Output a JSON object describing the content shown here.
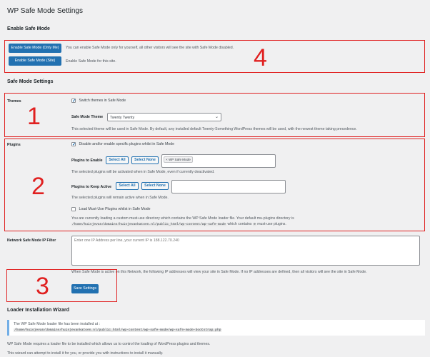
{
  "page": {
    "title": "WP Safe Mode Settings"
  },
  "enable_section": {
    "heading": "Enable Safe Mode",
    "only_me_button": "Enable Safe Mode (Only Me)",
    "only_me_desc": "You can enable Safe Mode only for yourself, all other visitors will see the site with Safe Mode disabled.",
    "site_button": "Enable Safe Mode (Site)",
    "site_desc": "Enable Safe Mode for this site."
  },
  "settings_section": {
    "heading": "Safe Mode Settings"
  },
  "themes": {
    "label": "Themes",
    "switch_checkbox_label": "Switch themes in Safe Mode",
    "switch_checked": true,
    "theme_label": "Safe Mode Theme",
    "theme_value": "Twenty Twenty",
    "desc": "This selected theme will be used in Safe Mode. By default, any installed default Twenty-Something WordPress themes will be used, with the newest theme taking precedence."
  },
  "plugins": {
    "label": "Plugins",
    "disable_checkbox_label": "Disable and/or enable specific plugins whilst in Safe Mode",
    "disable_checked": true,
    "enable_label": "Plugins to Enable",
    "select_all": "Select All",
    "select_none": "Select None",
    "enable_chip": "× WP Safe Mode",
    "enable_desc": "The selected plugins will be activated when in Safe Mode, even if currently deactivated.",
    "keep_label": "Plugins to Keep Active",
    "keep_desc": "The selected plugins will remain active when in Safe Mode.",
    "mu_checkbox_label": "Load Must-Use Plugins whilst in Safe Mode",
    "mu_checked": false,
    "mu_desc_1": "You are currently loading a custom must-use directory which contains the WP Safe Mode loader file. Your default mu-plugins directory is",
    "mu_path": "/home/huisjevan/domains/huisjevankatoen.nl/public_html/wp-content/wp-safe-mode",
    "mu_desc_2": "which contains",
    "mu_count": "0",
    "mu_desc_3": "must-use plugins."
  },
  "ip_filter": {
    "label": "Network Safe Mode IP Filter",
    "placeholder": "Enter one IP Address per line, your current IP is 188.122.70.240",
    "desc": "When Safe Mode is active on this Network, the following IP addresses will view your site in Safe Mode. If no IP addresses are defined, then all visitors will see the site in Safe Mode."
  },
  "save_button": "Save Settings",
  "loader": {
    "heading": "Loader Installation Wizard",
    "notice_line1": "The WP Safe Mode loader file has been installed at :",
    "notice_path": "/home/huisjevan/domains/huisjevankatoen.nl/public_html/wp-content/wp-safe-mode/wp-safe-mode-bootstrap.php",
    "para1": "WP Safe Mode requires a loader file to be installed which allows us to control the loading of WordPress plugins and themes.",
    "para2": "This wizard can attempt to install it for you, or provide you with instructions to install it manually."
  },
  "annotations": {
    "n1": "1",
    "n2": "2",
    "n3": "3",
    "n4": "4",
    "color": "#e02020"
  }
}
